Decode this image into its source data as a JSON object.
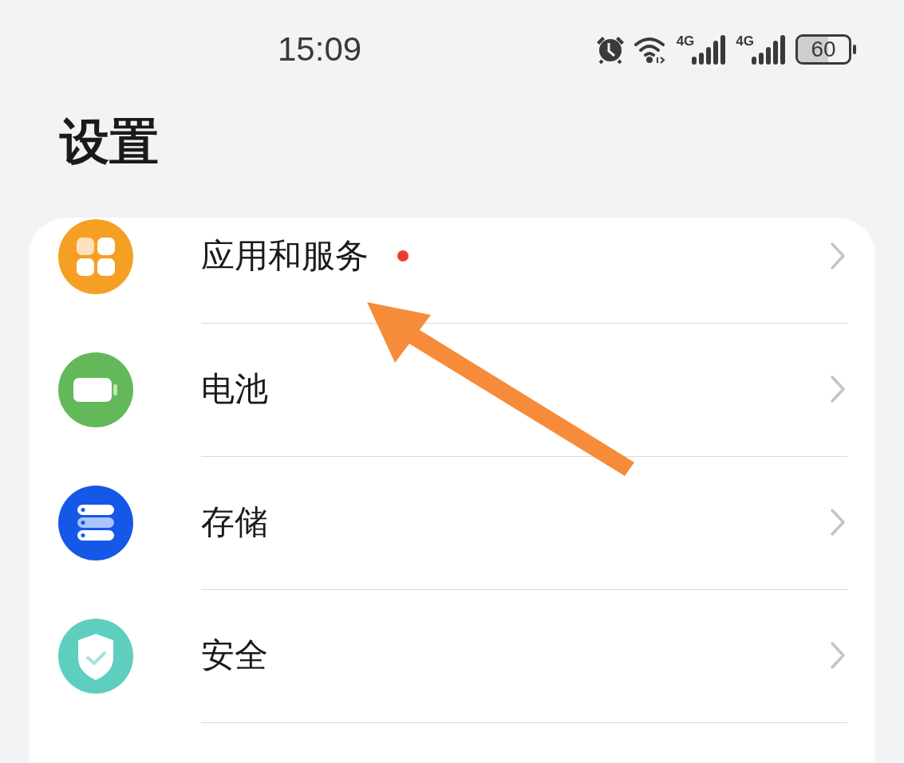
{
  "status_bar": {
    "time": "15:09",
    "signals": [
      {
        "label": "4G"
      },
      {
        "label": "4G"
      }
    ],
    "battery": {
      "label": "60",
      "level": 0.6
    }
  },
  "title": "设置",
  "items": [
    {
      "label": "应用和服务",
      "kind": "apps",
      "color": "#f5a024",
      "badge": true
    },
    {
      "label": "电池",
      "kind": "battery",
      "color": "#63b95a",
      "badge": false
    },
    {
      "label": "存储",
      "kind": "storage",
      "color": "#1558e8",
      "badge": false
    },
    {
      "label": "安全",
      "kind": "security",
      "color": "#5ecfbf",
      "badge": false
    }
  ]
}
